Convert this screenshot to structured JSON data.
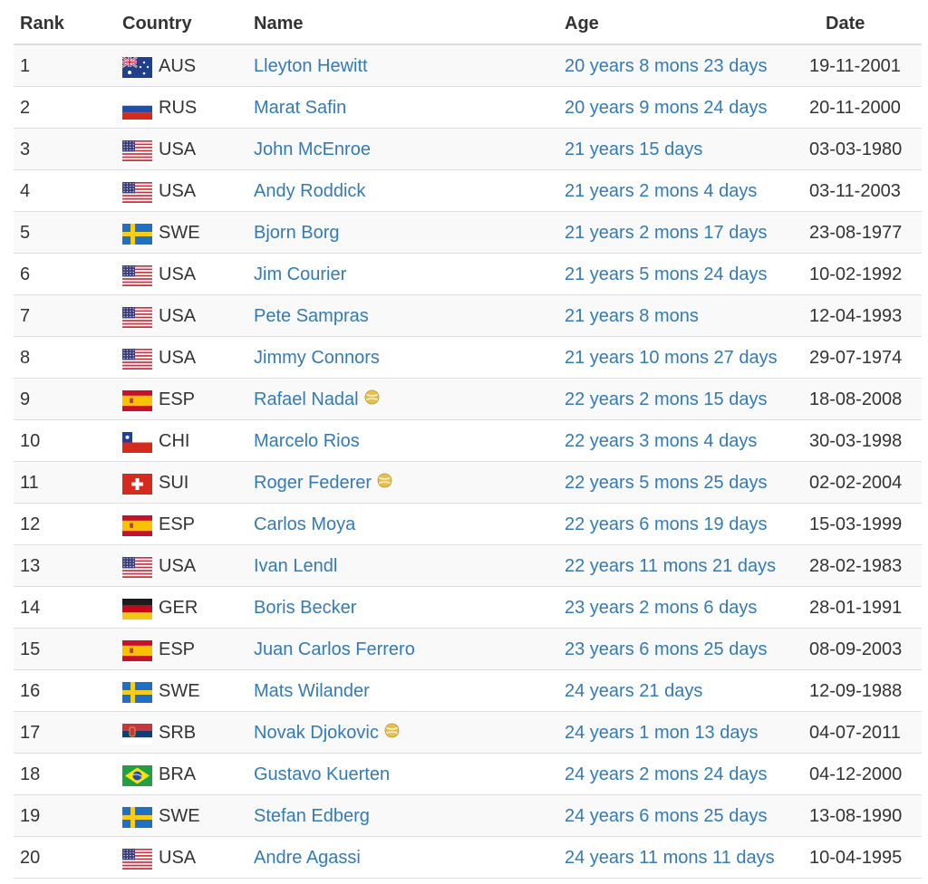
{
  "table": {
    "headers": {
      "rank": "Rank",
      "country": "Country",
      "name": "Name",
      "age": "Age",
      "date": "Date"
    },
    "rows": [
      {
        "rank": "1",
        "flag": "aus-flag-icon",
        "code": "AUS",
        "name": "Lleyton Hewitt",
        "ball": false,
        "age": "20 years 8 mons 23 days",
        "date": "19-11-2001"
      },
      {
        "rank": "2",
        "flag": "rus-flag-icon",
        "code": "RUS",
        "name": "Marat Safin",
        "ball": false,
        "age": "20 years 9 mons 24 days",
        "date": "20-11-2000"
      },
      {
        "rank": "3",
        "flag": "usa-flag-icon",
        "code": "USA",
        "name": "John McEnroe",
        "ball": false,
        "age": "21 years 15 days",
        "date": "03-03-1980"
      },
      {
        "rank": "4",
        "flag": "usa-flag-icon",
        "code": "USA",
        "name": "Andy Roddick",
        "ball": false,
        "age": "21 years 2 mons 4 days",
        "date": "03-11-2003"
      },
      {
        "rank": "5",
        "flag": "swe-flag-icon",
        "code": "SWE",
        "name": "Bjorn Borg",
        "ball": false,
        "age": "21 years 2 mons 17 days",
        "date": "23-08-1977"
      },
      {
        "rank": "6",
        "flag": "usa-flag-icon",
        "code": "USA",
        "name": "Jim Courier",
        "ball": false,
        "age": "21 years 5 mons 24 days",
        "date": "10-02-1992"
      },
      {
        "rank": "7",
        "flag": "usa-flag-icon",
        "code": "USA",
        "name": "Pete Sampras",
        "ball": false,
        "age": "21 years 8 mons",
        "date": "12-04-1993"
      },
      {
        "rank": "8",
        "flag": "usa-flag-icon",
        "code": "USA",
        "name": "Jimmy Connors",
        "ball": false,
        "age": "21 years 10 mons 27 days",
        "date": "29-07-1974"
      },
      {
        "rank": "9",
        "flag": "esp-flag-icon",
        "code": "ESP",
        "name": "Rafael Nadal",
        "ball": true,
        "age": "22 years 2 mons 15 days",
        "date": "18-08-2008"
      },
      {
        "rank": "10",
        "flag": "chi-flag-icon",
        "code": "CHI",
        "name": "Marcelo Rios",
        "ball": false,
        "age": "22 years 3 mons 4 days",
        "date": "30-03-1998"
      },
      {
        "rank": "11",
        "flag": "sui-flag-icon",
        "code": "SUI",
        "name": "Roger Federer",
        "ball": true,
        "age": "22 years 5 mons 25 days",
        "date": "02-02-2004"
      },
      {
        "rank": "12",
        "flag": "esp-flag-icon",
        "code": "ESP",
        "name": "Carlos Moya",
        "ball": false,
        "age": "22 years 6 mons 19 days",
        "date": "15-03-1999"
      },
      {
        "rank": "13",
        "flag": "usa-flag-icon",
        "code": "USA",
        "name": "Ivan Lendl",
        "ball": false,
        "age": "22 years 11 mons 21 days",
        "date": "28-02-1983"
      },
      {
        "rank": "14",
        "flag": "ger-flag-icon",
        "code": "GER",
        "name": "Boris Becker",
        "ball": false,
        "age": "23 years 2 mons 6 days",
        "date": "28-01-1991"
      },
      {
        "rank": "15",
        "flag": "esp-flag-icon",
        "code": "ESP",
        "name": "Juan Carlos Ferrero",
        "ball": false,
        "age": "23 years 6 mons 25 days",
        "date": "08-09-2003"
      },
      {
        "rank": "16",
        "flag": "swe-flag-icon",
        "code": "SWE",
        "name": "Mats Wilander",
        "ball": false,
        "age": "24 years 21 days",
        "date": "12-09-1988"
      },
      {
        "rank": "17",
        "flag": "srb-flag-icon",
        "code": "SRB",
        "name": "Novak Djokovic",
        "ball": true,
        "age": "24 years 1 mon 13 days",
        "date": "04-07-2011"
      },
      {
        "rank": "18",
        "flag": "bra-flag-icon",
        "code": "BRA",
        "name": "Gustavo Kuerten",
        "ball": false,
        "age": "24 years 2 mons 24 days",
        "date": "04-12-2000"
      },
      {
        "rank": "19",
        "flag": "swe-flag-icon",
        "code": "SWE",
        "name": "Stefan Edberg",
        "ball": false,
        "age": "24 years 6 mons 25 days",
        "date": "13-08-1990"
      },
      {
        "rank": "20",
        "flag": "usa-flag-icon",
        "code": "USA",
        "name": "Andre Agassi",
        "ball": false,
        "age": "24 years 11 mons 11 days",
        "date": "10-04-1995"
      }
    ]
  },
  "colors": {
    "link": "#337ab7",
    "text": "#333333",
    "border": "#dddddd",
    "stripe": "#f9f9f9",
    "ball": "#e8c14a"
  }
}
